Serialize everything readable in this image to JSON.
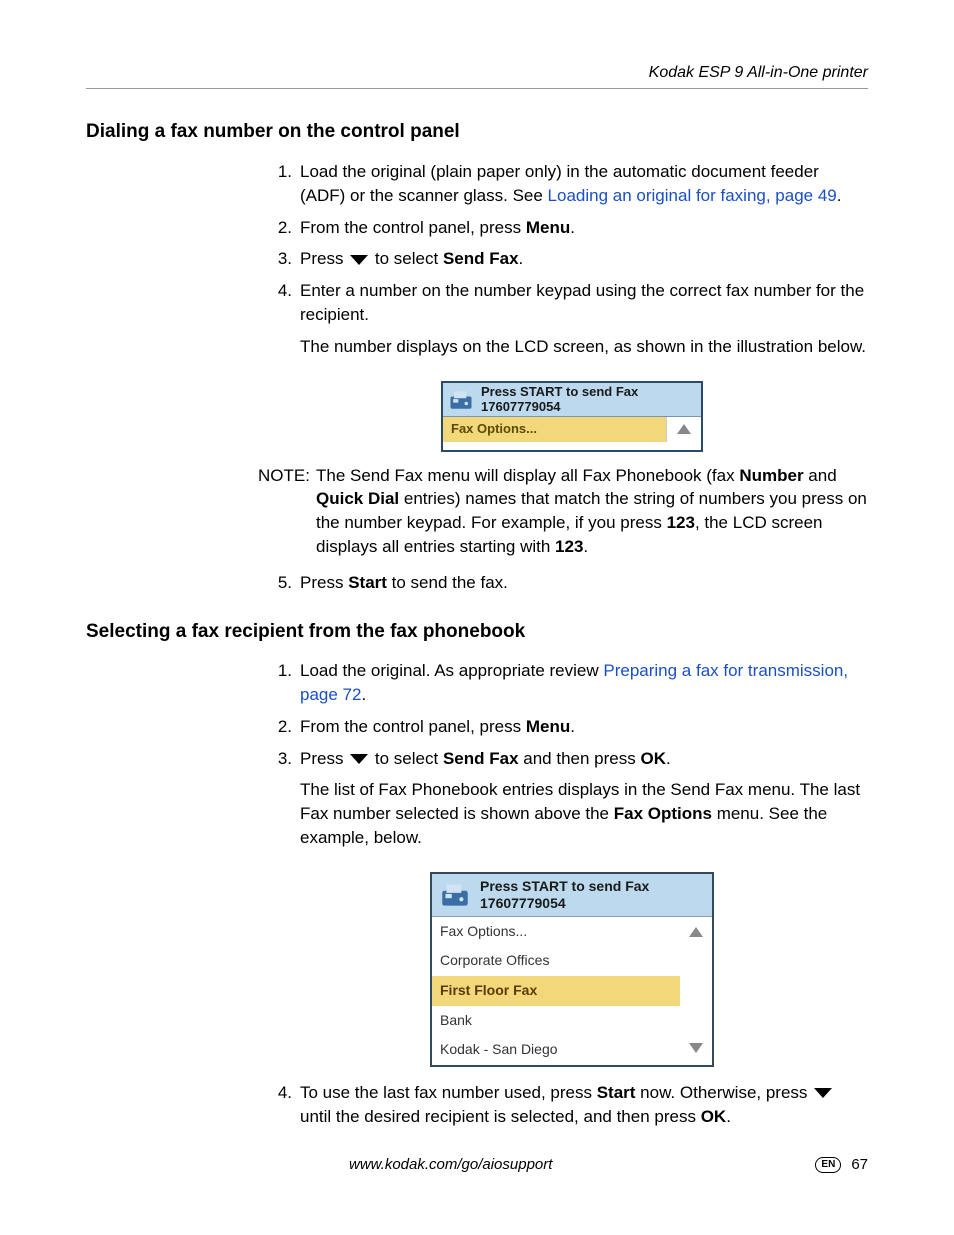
{
  "header": {
    "product": "Kodak ESP 9 All-in-One printer"
  },
  "section1": {
    "heading": "Dialing a fax number on the control panel",
    "steps": {
      "s1": {
        "num": "1.",
        "pre": "Load the original (plain paper only) in the automatic document feeder (ADF) or the scanner glass. See ",
        "link": "Loading an original for faxing, page 49",
        "post": "."
      },
      "s2": {
        "num": "2.",
        "pre": "From the control panel, press ",
        "bold": "Menu",
        "post": "."
      },
      "s3": {
        "num": "3.",
        "pre": "Press ",
        "mid": " to select ",
        "bold": "Send Fax",
        "post": "."
      },
      "s4": {
        "num": "4.",
        "line1": "Enter a number on the number keypad using the correct fax number for the recipient.",
        "line2": "The number displays on the LCD screen, as shown in the illustration below."
      },
      "s5": {
        "num": "5.",
        "pre": "Press ",
        "bold": "Start",
        "post": " to send the fax."
      }
    },
    "note": {
      "label": "NOTE:",
      "t1": "The Send Fax menu will display all Fax Phonebook (fax ",
      "b1": "Number",
      "t2": " and ",
      "b2": "Quick Dial",
      "t3": " entries) names that match the string of numbers you press on the number keypad. For example, if you press ",
      "b3": "123",
      "t4": ", the LCD screen displays all entries starting with ",
      "b4": "123",
      "t5": "."
    }
  },
  "lcd1": {
    "title1": "Press START to send Fax",
    "title2": "17607779054",
    "faxoptions": "Fax Options..."
  },
  "section2": {
    "heading": "Selecting a fax recipient from the fax phonebook",
    "steps": {
      "s1": {
        "num": "1.",
        "pre": "Load the original. As appropriate review ",
        "link": "Preparing a fax for transmission, page 72",
        "post": "."
      },
      "s2": {
        "num": "2.",
        "pre": "From the control panel, press ",
        "bold": "Menu",
        "post": "."
      },
      "s3": {
        "num": "3.",
        "pre": "Press ",
        "mid1": " to select ",
        "b1": "Send Fax",
        "mid2": " and then press ",
        "b2": "OK",
        "post": ".",
        "line2a": "The list of Fax Phonebook entries displays in the Send Fax menu. The last Fax number selected is shown above the ",
        "line2b": "Fax Options",
        "line2c": " menu. See the example, below."
      },
      "s4": {
        "num": "4.",
        "t1": "To use the last fax number used, press ",
        "b1": "Start",
        "t2": " now. Otherwise, press ",
        "t3": " until the desired recipient is selected, and then press ",
        "b2": "OK",
        "t4": "."
      }
    }
  },
  "lcd2": {
    "title1": "Press START to send Fax",
    "title2": "17607779054",
    "items": {
      "i0": "Fax Options...",
      "i1": "Corporate Offices",
      "i2": "First Floor Fax",
      "i3": "Bank",
      "i4": "Kodak - San Diego"
    }
  },
  "footer": {
    "url": "www.kodak.com/go/aiosupport",
    "lang": "EN",
    "page": "67"
  }
}
